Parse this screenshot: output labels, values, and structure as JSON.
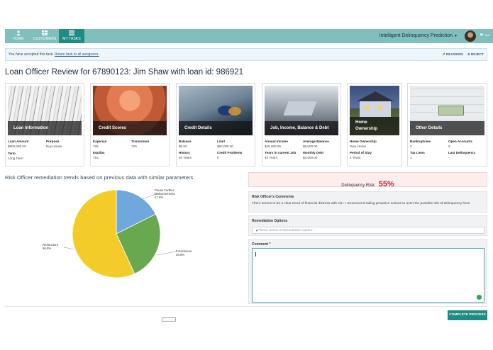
{
  "nav": {
    "items": [
      {
        "label": "HOME",
        "icon": "user-icon"
      },
      {
        "label": "CUSTOMERS",
        "icon": "grid-icon"
      },
      {
        "label": "MY TASKS",
        "icon": "list-icon"
      }
    ],
    "app_title": "Intelligent Delinquency Prediction",
    "send_label": "Bot",
    "accent": "#7fc0bd",
    "active_color": "#1f8b85"
  },
  "banner": {
    "message": "You have accepted this task.",
    "link": "Return task to all assignees.",
    "reassign": "REASSIGN",
    "reject": "REJECT"
  },
  "page_title": "Loan Officer Review for 67890123: Jim Shaw with loan id: 986921",
  "cards": [
    {
      "title": "Loan Information",
      "fields": [
        {
          "k": "Loan Amount",
          "v": "$800,000.00"
        },
        {
          "k": "Purpose",
          "v": "Buy House"
        },
        {
          "k": "Term",
          "v": "Long Term"
        }
      ]
    },
    {
      "title": "Credit Scores",
      "fields": [
        {
          "k": "Experian",
          "v": "725"
        },
        {
          "k": "TransUnion",
          "v": "720"
        },
        {
          "k": "Equifax",
          "v": "715"
        }
      ]
    },
    {
      "title": "Credit Details",
      "fields": [
        {
          "k": "Balance",
          "v": "$0.00"
        },
        {
          "k": "Limit",
          "v": "$60,000.00"
        },
        {
          "k": "History",
          "v": "40 Years"
        },
        {
          "k": "Credit Problems",
          "v": "5"
        }
      ]
    },
    {
      "title": "Job, Income, Balance & Debt",
      "fields": [
        {
          "k": "Annual Income",
          "v": "$45,000.00"
        },
        {
          "k": "Average Balance",
          "v": "$8,000.00"
        },
        {
          "k": "Years in current Job",
          "v": "40 Years"
        },
        {
          "k": "Monthly Debt",
          "v": "$3,500.00"
        }
      ]
    },
    {
      "title": "Home Ownership",
      "title2": "Ownership",
      "title1": "Home",
      "fields": [
        {
          "k": "Home Ownership",
          "v": "Own Home"
        },
        {
          "k": "Period of Stay",
          "v": "2 Years"
        }
      ]
    },
    {
      "title": "Other Details",
      "fields": [
        {
          "k": "Bankruptcies",
          "v": "0"
        },
        {
          "k": "Open Accounts",
          "v": "9"
        },
        {
          "k": "Tax Liens",
          "v": "1"
        },
        {
          "k": "Last Delinquency",
          "v": "-"
        }
      ]
    }
  ],
  "trend_title": "Risk Officer remediation trends based on previous data with similar parameters.",
  "chart_data": {
    "type": "pie",
    "slices": [
      {
        "label": "Pause Further Disbursements",
        "value": 17.6,
        "display": "17.6%",
        "color": "#6fa8dc"
      },
      {
        "label": "Foreclosure",
        "value": 25.6,
        "display": "25.6%",
        "color": "#6aa84f"
      },
      {
        "label": "Restructure",
        "value": 56.8,
        "display": "56.8%",
        "color": "#f4cc2a"
      }
    ]
  },
  "risk": {
    "label": "Delinquency Risk:",
    "value": "55%",
    "color": "#c3223a"
  },
  "comments": {
    "header": "Risk Officer's Comments",
    "text": "There seems to be a clear trend of financial distress with Jim. I recommend taking proactive actions to avert the possible risk of delinquency here."
  },
  "remediation": {
    "header": "Remediation Options",
    "placeholder": "--Please Select a Remediation Option--"
  },
  "comment": {
    "header": "Comment *",
    "value": ""
  },
  "complete_button": "COMPLETE PROCESS"
}
